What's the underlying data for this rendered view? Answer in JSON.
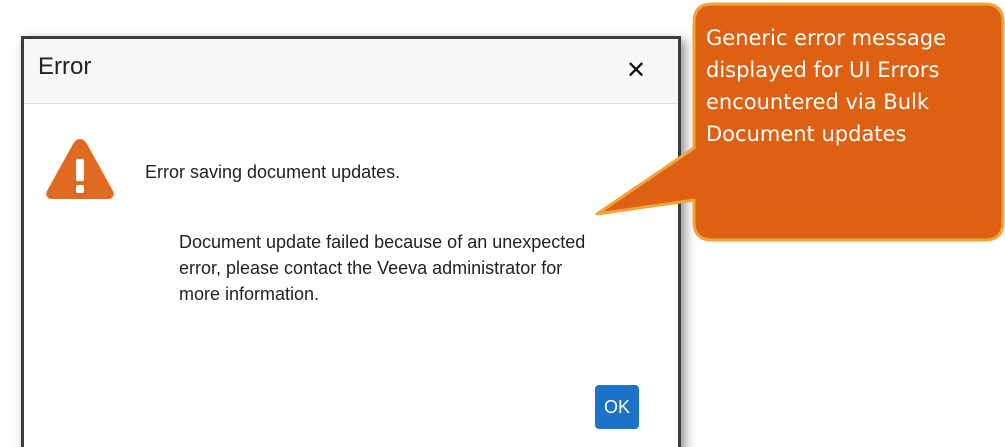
{
  "dialog": {
    "title": "Error",
    "close_icon": "close-icon",
    "close_glyph": "✕",
    "warning_icon": "warning-triangle-icon",
    "heading": "Error saving document updates.",
    "detail": "Document update failed because of an unexpected error, please contact the Veeva administrator for more information.",
    "ok_label": "OK"
  },
  "callout": {
    "lines": [
      "Generic error message",
      "displayed for UI Errors",
      "encountered via Bulk",
      "Document updates"
    ]
  },
  "colors": {
    "warning": "#e16a22",
    "callout_fill": "#dd6013",
    "callout_border": "#f2a33a",
    "ok_button": "#1a73c7"
  }
}
